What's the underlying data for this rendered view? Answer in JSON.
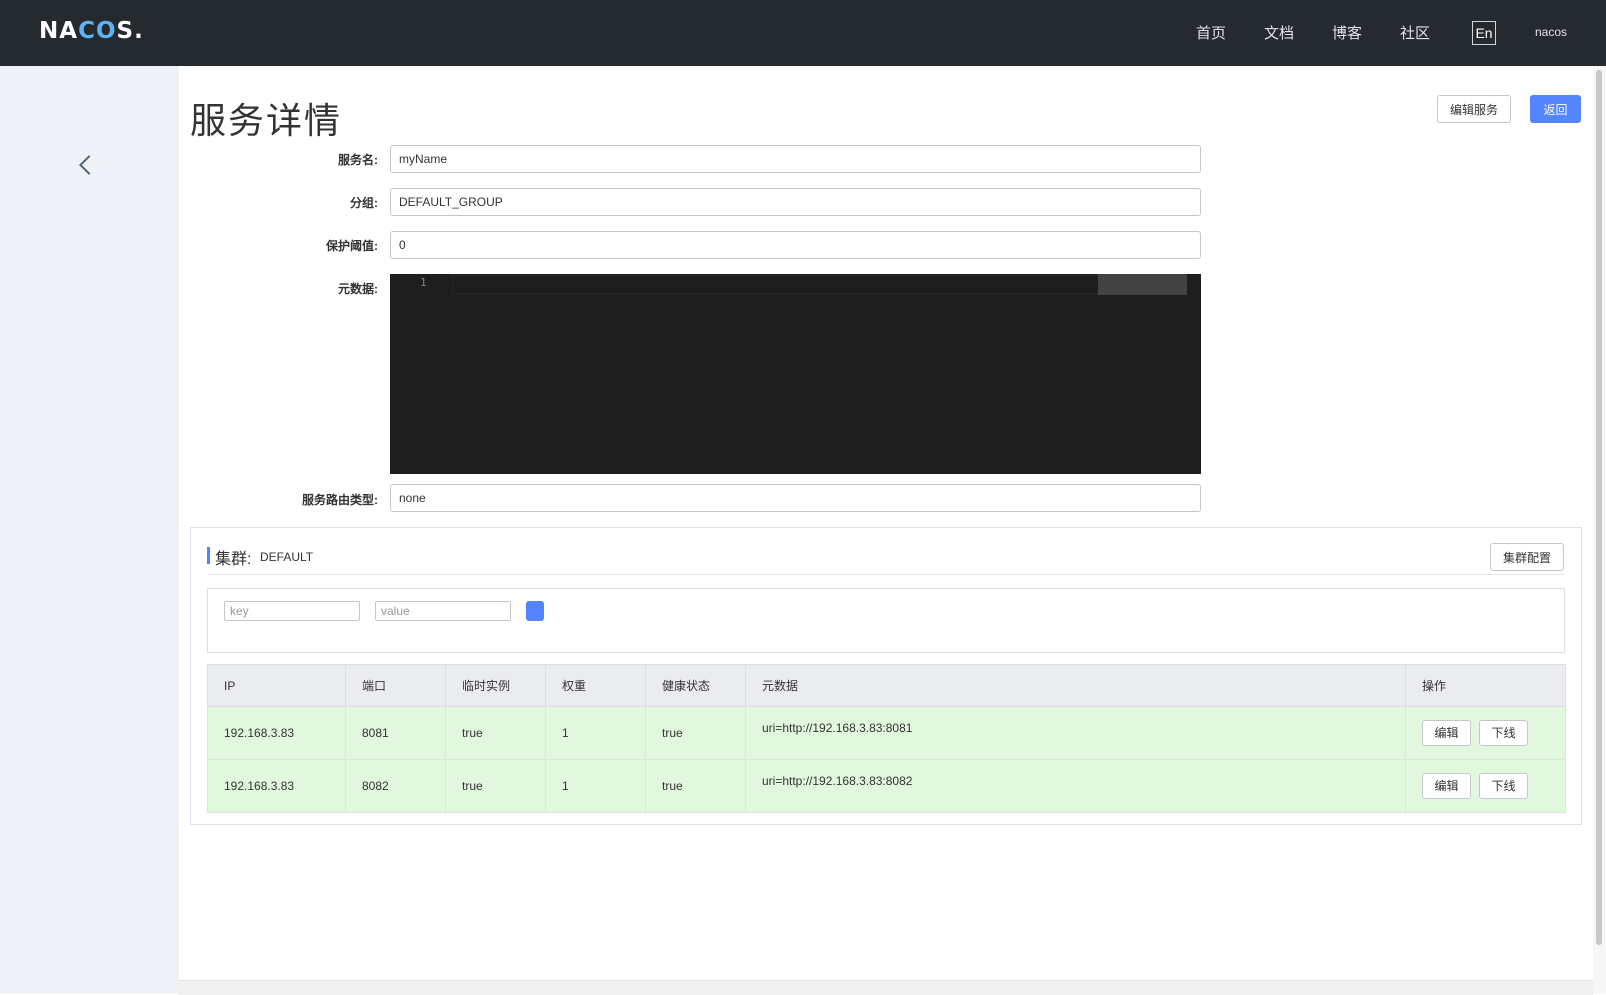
{
  "nav": {
    "logo_left": "NA",
    "logo_mid": "CO",
    "logo_right": "S.",
    "links": [
      "首页",
      "文档",
      "博客",
      "社区"
    ],
    "lang": "En",
    "user": "nacos"
  },
  "page": {
    "title": "服务详情",
    "edit_button": "编辑服务",
    "back_button": "返回"
  },
  "form": {
    "service_name_label": "服务名:",
    "service_name": "myName",
    "group_label": "分组:",
    "group": "DEFAULT_GROUP",
    "threshold_label": "保护阈值:",
    "threshold": "0",
    "metadata_label": "元数据:",
    "editor_line": "1",
    "selector_label": "服务路由类型:",
    "selector": "none"
  },
  "cluster": {
    "label": "集群:",
    "name": "DEFAULT",
    "config_button": "集群配置",
    "key_placeholder": "key",
    "value_placeholder": "value",
    "columns": [
      "IP",
      "端口",
      "临时实例",
      "权重",
      "健康状态",
      "元数据",
      "操作"
    ],
    "rows": [
      {
        "ip": "192.168.3.83",
        "port": "8081",
        "ephemeral": "true",
        "weight": "1",
        "healthy": "true",
        "metadata": "uri=http://192.168.3.83:8081",
        "edit": "编辑",
        "offline": "下线"
      },
      {
        "ip": "192.168.3.83",
        "port": "8082",
        "ephemeral": "true",
        "weight": "1",
        "healthy": "true",
        "metadata": "uri=http://192.168.3.83:8082",
        "edit": "编辑",
        "offline": "下线"
      }
    ]
  }
}
